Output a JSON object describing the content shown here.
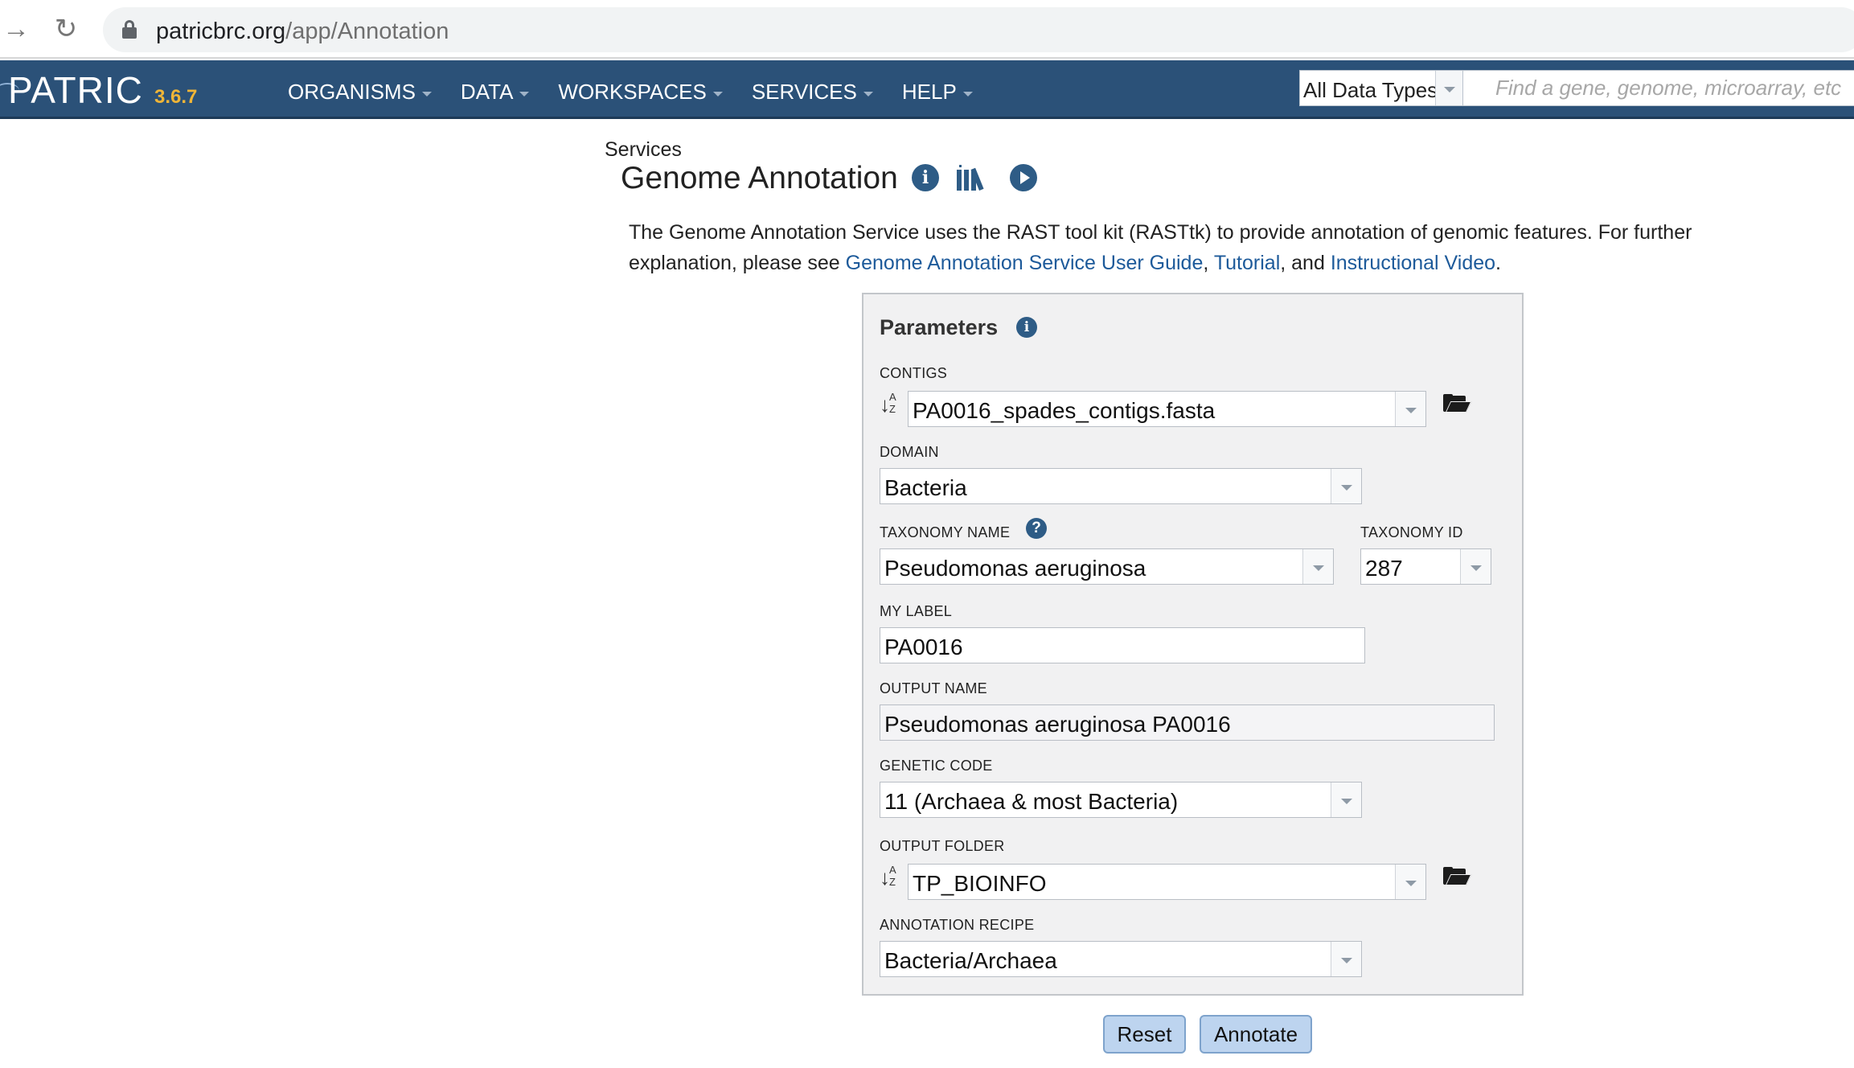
{
  "browser": {
    "url_host": "patricbrc.org",
    "url_path": "/app/Annotation"
  },
  "header": {
    "logo": "PATRIC",
    "version": "3.6.7",
    "menu": [
      {
        "label": "ORGANISMS"
      },
      {
        "label": "DATA"
      },
      {
        "label": "WORKSPACES"
      },
      {
        "label": "SERVICES"
      },
      {
        "label": "HELP"
      }
    ],
    "search_type": "All Data Types",
    "search_placeholder": "Find a gene, genome, microarray, etc"
  },
  "page": {
    "breadcrumb": "Services",
    "title": "Genome Annotation",
    "description": {
      "text": "The Genome Annotation Service uses the RAST tool kit (RASTtk) to provide annotation of genomic features. For further explanation, please see ",
      "link1": "Genome Annotation Service User Guide",
      "sep1": ", ",
      "link2": "Tutorial",
      "sep2": ", and ",
      "link3": "Instructional Video",
      "end": "."
    }
  },
  "form": {
    "title": "Parameters",
    "contigs": {
      "label": "CONTIGS",
      "value": "PA0016_spades_contigs.fasta"
    },
    "domain": {
      "label": "DOMAIN",
      "value": "Bacteria"
    },
    "taxonomy_name": {
      "label": "TAXONOMY NAME",
      "value": "Pseudomonas aeruginosa"
    },
    "taxonomy_id": {
      "label": "TAXONOMY ID",
      "value": "287"
    },
    "my_label": {
      "label": "MY LABEL",
      "value": "PA0016"
    },
    "output_name": {
      "label": "OUTPUT NAME",
      "value": "Pseudomonas aeruginosa PA0016"
    },
    "genetic_code": {
      "label": "GENETIC CODE",
      "value": "11 (Archaea & most Bacteria)"
    },
    "output_folder": {
      "label": "OUTPUT FOLDER",
      "value": "TP_BIOINFO"
    },
    "annotation_recipe": {
      "label": "ANNOTATION RECIPE",
      "value": "Bacteria/Archaea"
    },
    "sort_icon_text": "A Z"
  },
  "buttons": {
    "reset": "Reset",
    "annotate": "Annotate"
  },
  "colors": {
    "header_bg": "#2b5178",
    "version": "#f0b537",
    "link": "#1d5a9a",
    "button_bg": "#bdd4ef"
  }
}
